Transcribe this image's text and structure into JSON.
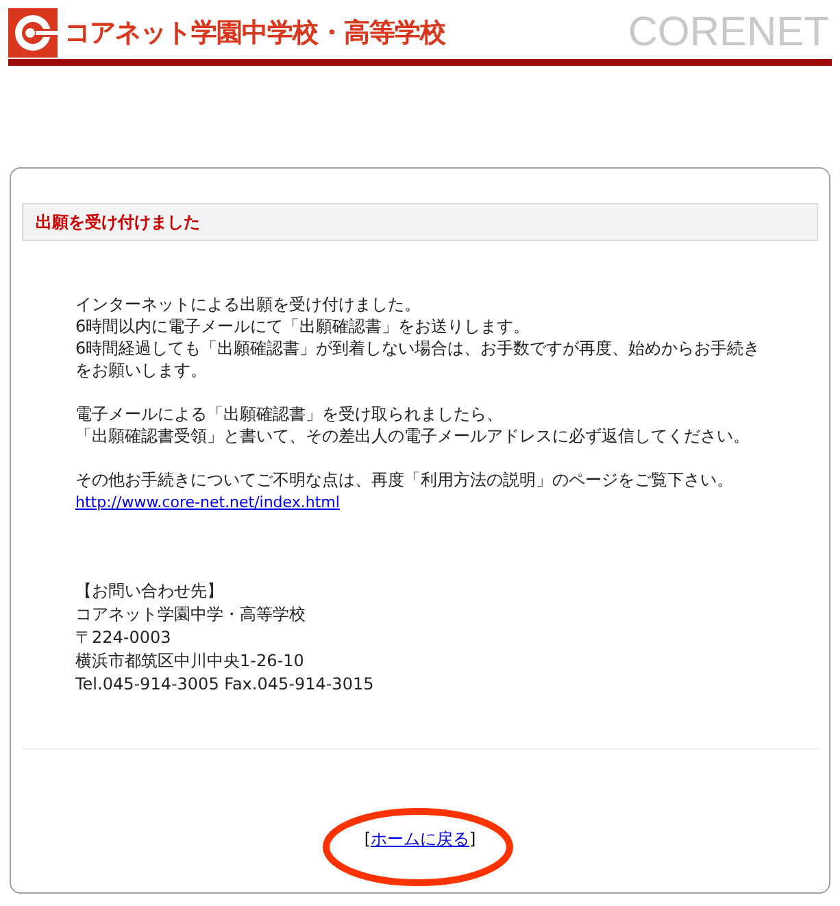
{
  "header": {
    "school_name": "コアネット学園中学校・高等学校",
    "brand": "CORENET"
  },
  "notice": {
    "heading": "出願を受け付けました",
    "paragraphs": [
      [
        "インターネットによる出願を受け付けました。",
        "6時間以内に電子メールにて「出願確認書」をお送りします。",
        "6時間経過しても「出願確認書」が到着しない場合は、お手数ですが再度、始めからお手続きをお願いします。"
      ],
      [
        "電子メールによる「出願確認書」を受け取られましたら、",
        "「出願確認書受領」と書いて、その差出人の電子メールアドレスに必ず返信してください。"
      ],
      [
        "その他お手続きについてご不明な点は、再度「利用方法の説明」のページをご覧下さい。"
      ]
    ],
    "link": "http://www.core-net.net/index.html",
    "contact_lines": [
      "【お問い合わせ先】",
      "コアネット学園中学・高等学校",
      "〒224-0003",
      "横浜市都筑区中川中央1-26-10",
      "Tel.045-914-3005 Fax.045-914-3015"
    ]
  },
  "back_link": {
    "open": "[",
    "label": "ホームに戻る",
    "close": "]"
  }
}
